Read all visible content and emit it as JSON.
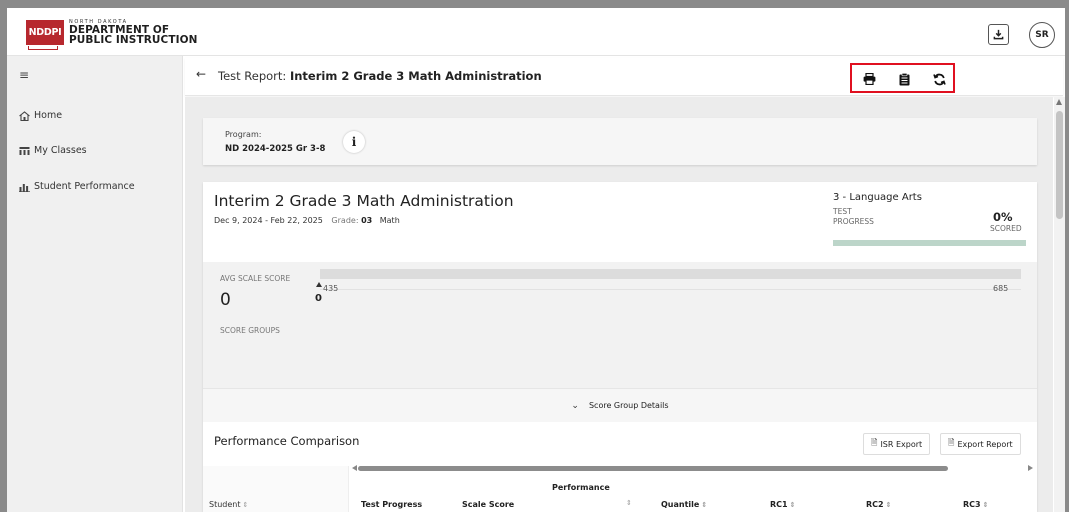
{
  "header": {
    "logo_box": "NDDPI",
    "logo_small": "NORTH DAKOTA",
    "logo_line1": "DEPARTMENT OF",
    "logo_line2": "PUBLIC INSTRUCTION",
    "user_initials": "SR"
  },
  "sidebar": {
    "items": [
      {
        "label": "Home",
        "icon": "home-icon"
      },
      {
        "label": "My Classes",
        "icon": "classes-icon"
      },
      {
        "label": "Student Performance",
        "icon": "chart-icon"
      }
    ]
  },
  "titlebar": {
    "prefix": "Test Report: ",
    "name": "Interim 2 Grade 3 Math Administration"
  },
  "program": {
    "label": "Program:",
    "value": "ND 2024-2025 Gr 3-8",
    "info_symbol": "i"
  },
  "test": {
    "title": "Interim 2 Grade 3 Math Administration",
    "dates": "Dec 9, 2024 - Feb 22, 2025",
    "grade_label": "Grade:",
    "grade_value": "03",
    "subject": "Math",
    "progress_subject": "3 - Language Arts",
    "progress_label": "TEST PROGRESS",
    "progress_percent": "0%",
    "progress_value": 0,
    "scored_label": "SCORED"
  },
  "score": {
    "avg_label": "AVG SCALE SCORE",
    "avg_value": "0",
    "min": "435",
    "max": "685",
    "marker_value": "0",
    "groups_label": "SCORE GROUPS",
    "details_label": "Score Group Details"
  },
  "performance": {
    "title": "Performance Comparison",
    "isr_export": "ISR Export",
    "export_report": "Export Report",
    "columns": {
      "student": "Student",
      "test_progress": "Test Progress",
      "scale_score": "Scale Score",
      "performance": "Performance",
      "quantile": "Quantile",
      "rc1": "RC1",
      "rc2": "RC2",
      "rc3": "RC3"
    }
  },
  "colors": {
    "brand": "#b7282e",
    "highlight_box": "#e01020",
    "progress_track": "#bcd5c9"
  }
}
